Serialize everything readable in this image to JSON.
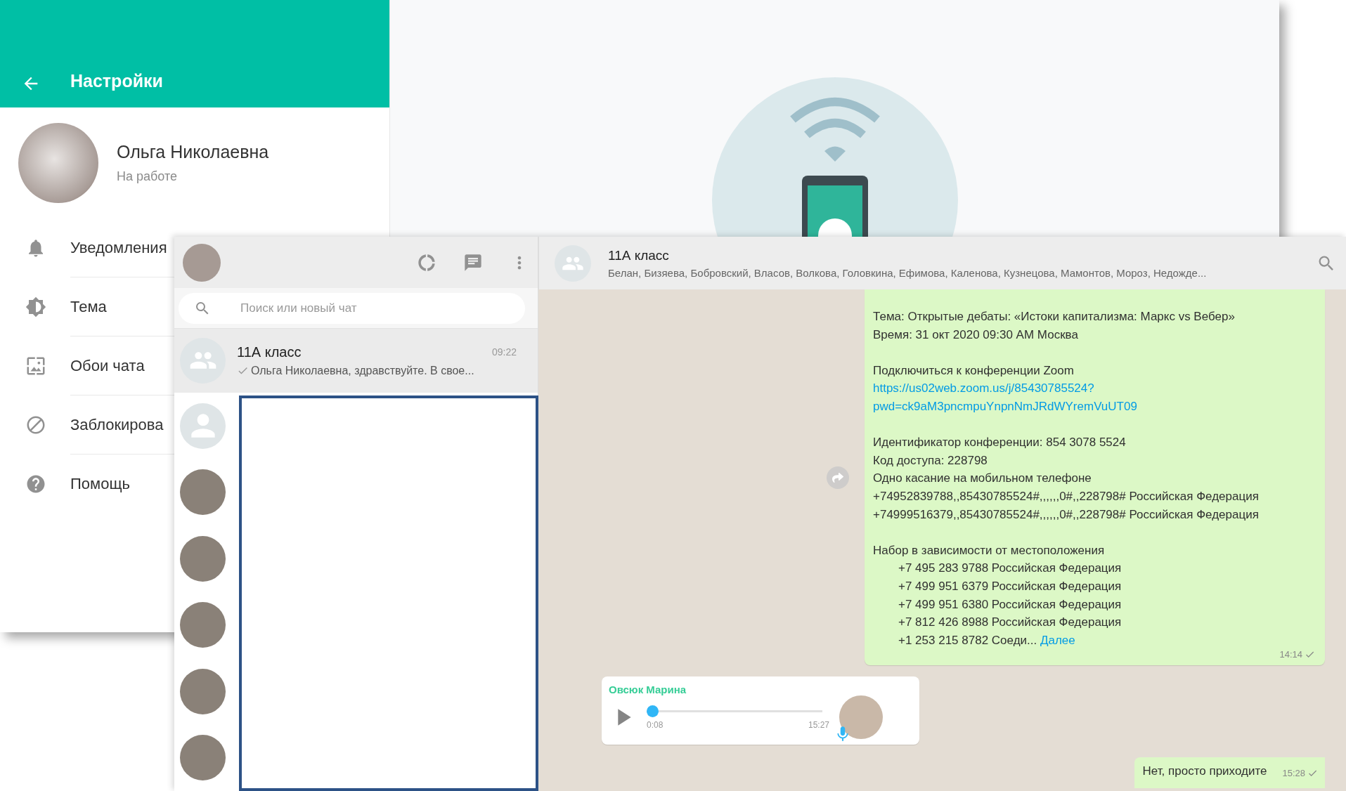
{
  "settings": {
    "title": "Настройки",
    "profile": {
      "name": "Ольга Николаевна",
      "status": "На работе"
    },
    "items": [
      {
        "kind": "notifications",
        "label": "Уведомления"
      },
      {
        "kind": "theme",
        "label": "Тема"
      },
      {
        "kind": "wallpaper",
        "label": "Обои чата"
      },
      {
        "kind": "blocked",
        "label": "Заблокирова"
      },
      {
        "kind": "help",
        "label": "Помощь"
      }
    ]
  },
  "search": {
    "placeholder": "Поиск или новый чат"
  },
  "chats": [
    {
      "kind": "group",
      "name": "11А класс",
      "time": "09:22",
      "preview": "Ольга Николаевна, здравствуйте. В свое...",
      "delivered": true,
      "selected": true
    },
    {
      "kind": "default",
      "selected": false
    },
    {
      "kind": "photo",
      "selected": false
    },
    {
      "kind": "photo",
      "selected": false
    },
    {
      "kind": "photo",
      "selected": false
    },
    {
      "kind": "photo",
      "selected": false
    },
    {
      "kind": "photo",
      "selected": false
    }
  ],
  "chat": {
    "title": "11А класс",
    "members": "Белан, Бизяева, Бобровский, Власов, Волкова, Головкина, Ефимова, Каленова, Кузнецова, Мамонтов, Мороз, Недожде...",
    "message": {
      "time": "14:14",
      "delivered": true,
      "lines": [
        {
          "kind": "text",
          "text": "Тема: Открытые дебаты: «Истоки капитализма: Маркс vs Вебер»"
        },
        {
          "kind": "text",
          "text": "Время: 31 окт 2020 09:30 AM Москва"
        },
        {
          "kind": "gap"
        },
        {
          "kind": "text",
          "text": "Подключиться к конференции Zoom"
        },
        {
          "kind": "link",
          "text": "https://us02web.zoom.us/j/85430785524?"
        },
        {
          "kind": "link",
          "text": "pwd=ck9aM3pncmpuYnpnNmJRdWYremVuUT09"
        },
        {
          "kind": "gap"
        },
        {
          "kind": "text",
          "text": "Идентификатор конференции: 854 3078 5524"
        },
        {
          "kind": "text",
          "text": "Код доступа: 228798"
        },
        {
          "kind": "text",
          "text": "Одно касание на мобильном телефоне"
        },
        {
          "kind": "text",
          "text": "+74952839788,,85430785524#,,,,,,0#,,228798# Российская Федерация"
        },
        {
          "kind": "text",
          "text": "+74999516379,,85430785524#,,,,,,0#,,228798# Российская Федерация"
        },
        {
          "kind": "gap"
        },
        {
          "kind": "text",
          "text": "Набор в зависимости от местоположения"
        },
        {
          "kind": "indent",
          "text": "+7 495 283 9788 Российская Федерация"
        },
        {
          "kind": "indent",
          "text": "+7 499 951 6379 Российская Федерация"
        },
        {
          "kind": "indent",
          "text": "+7 499 951 6380 Российская Федерация"
        },
        {
          "kind": "indent",
          "text": "+7 812 426 8988 Российская Федерация"
        },
        {
          "kind": "indent",
          "text": "+1 253 215 8782 Соеди...",
          "more": "Далее"
        }
      ]
    },
    "voice": {
      "sender": "Овсюк Марина",
      "position": "0:08",
      "time": "15:27",
      "level": 0
    },
    "reply": {
      "text": "Нет, просто приходите",
      "time": "15:28",
      "delivered": true
    }
  }
}
